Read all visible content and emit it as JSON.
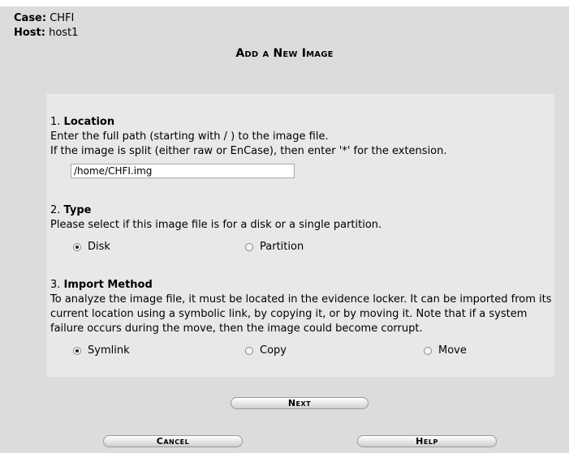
{
  "case_info": {
    "case_label": "Case:",
    "case_value": "CHFI",
    "host_label": "Host:",
    "host_value": "host1"
  },
  "title": "Add a New Image",
  "location": {
    "number": "1.",
    "heading": "Location",
    "line1": "Enter the full path (starting with / ) to the image file.",
    "line2": "If the image is split (either raw or EnCase), then enter '*' for the extension.",
    "path_value": "/home/CHFI.img"
  },
  "type": {
    "number": "2.",
    "heading": "Type",
    "description": "Please select if this image file is for a disk or a single partition.",
    "options": [
      "Disk",
      "Partition"
    ],
    "selected": "Disk"
  },
  "import": {
    "number": "3.",
    "heading": "Import Method",
    "line1": "To analyze the image file, it must be located in the evidence locker. It can be imported from its",
    "line2": "current location using a symbolic link, by copying it, or by moving it. Note that if a system",
    "line3": "failure occurs during the move, then the image could become corrupt.",
    "options": [
      "Symlink",
      "Copy",
      "Move"
    ],
    "selected": "Symlink"
  },
  "buttons": {
    "next": "Next",
    "cancel": "Cancel",
    "help": "Help"
  }
}
